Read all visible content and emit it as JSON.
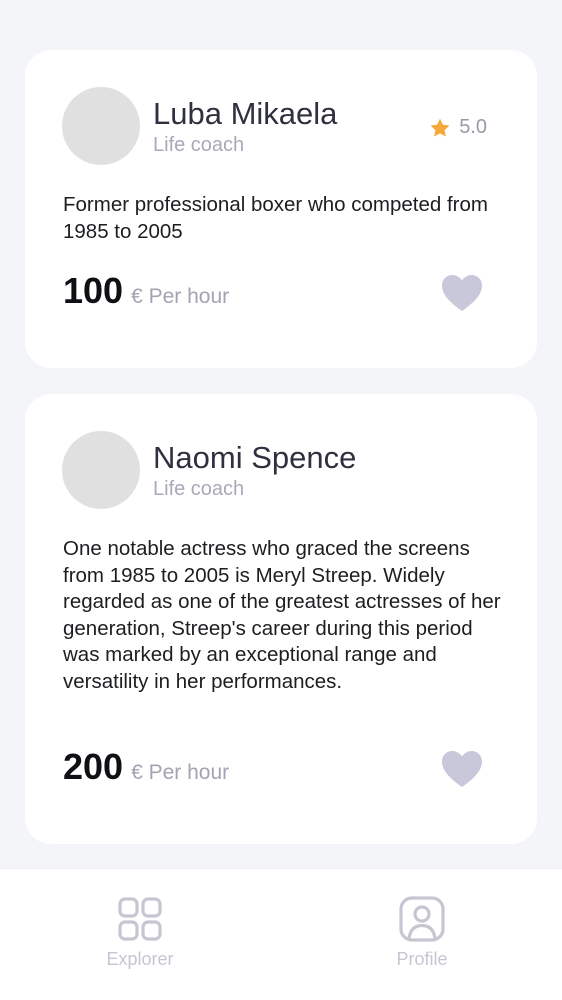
{
  "coaches": [
    {
      "name": "Luba Mikaela",
      "role": "Life coach",
      "rating": "5.0",
      "bio": "Former professional boxer who competed from 1985 to 2005",
      "price": "100",
      "price_unit": "€ Per hour"
    },
    {
      "name": "Naomi Spence",
      "role": "Life coach",
      "bio": "One notable actress who graced the screens from 1985 to 2005 is Meryl Streep. Widely regarded as one of the greatest actresses of her generation, Streep's career during this period was marked by an exceptional range and versatility in her performances.",
      "price": "200",
      "price_unit": "€ Per hour"
    }
  ],
  "tabbar": {
    "tabs": [
      {
        "label": "Explorer",
        "icon": "grid-icon"
      },
      {
        "label": "Profile",
        "icon": "user-icon"
      }
    ]
  },
  "colors": {
    "background": "#f4f5f9",
    "card": "#ffffff",
    "star": "#f5a93a",
    "heart": "#c9c8da",
    "tab_inactive": "#c6c6d2"
  }
}
